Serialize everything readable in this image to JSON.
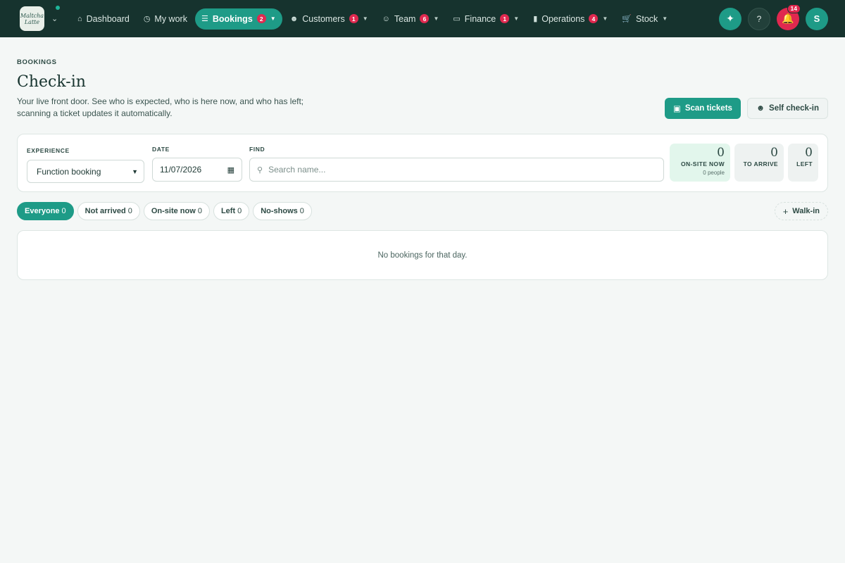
{
  "brand": {
    "logo_text": "Maltcha Latte"
  },
  "nav": {
    "items": [
      {
        "label": "Dashboard",
        "icon": "home-icon",
        "badge": null,
        "has_menu": false,
        "active": false
      },
      {
        "label": "My work",
        "icon": "clock-icon",
        "badge": null,
        "has_menu": false,
        "active": false
      },
      {
        "label": "Bookings",
        "icon": "list-icon",
        "badge": "2",
        "has_menu": true,
        "active": true
      },
      {
        "label": "Customers",
        "icon": "users-icon",
        "badge": "1",
        "has_menu": true,
        "active": false
      },
      {
        "label": "Team",
        "icon": "person-icon",
        "badge": "6",
        "has_menu": true,
        "active": false
      },
      {
        "label": "Finance",
        "icon": "card-icon",
        "badge": "1",
        "has_menu": true,
        "active": false
      },
      {
        "label": "Operations",
        "icon": "clipboard-icon",
        "badge": "4",
        "has_menu": true,
        "active": false
      },
      {
        "label": "Stock",
        "icon": "cart-icon",
        "badge": null,
        "has_menu": true,
        "active": false
      }
    ]
  },
  "topbar": {
    "notifications_count": "14",
    "avatar_initial": "S"
  },
  "page": {
    "eyebrow": "BOOKINGS",
    "title": "Check-in",
    "subtitle": "Your live front door. See who is expected, who is here now, and who has left; scanning a ticket updates it automatically.",
    "scan_label": "Scan tickets",
    "self_checkin_label": "Self check-in"
  },
  "filters": {
    "experience_label": "EXPERIENCE",
    "experience_value": "Function booking",
    "date_label": "DATE",
    "date_value": "11/07/2026",
    "find_label": "FIND",
    "find_placeholder": "Search name..."
  },
  "stats": {
    "onsite_value": "0",
    "onsite_label": "ON-SITE NOW",
    "onsite_sub": "0 people",
    "arrive_value": "0",
    "arrive_label": "TO ARRIVE",
    "left_value": "0",
    "left_label": "LEFT"
  },
  "tabs": [
    {
      "label": "Everyone",
      "count": "0"
    },
    {
      "label": "Not arrived",
      "count": "0"
    },
    {
      "label": "On-site now",
      "count": "0"
    },
    {
      "label": "Left",
      "count": "0"
    },
    {
      "label": "No-shows",
      "count": "0"
    }
  ],
  "walkin_label": "Walk-in",
  "empty_message": "No bookings for that day.",
  "colors": {
    "accent": "#1e9b87",
    "nav_bg": "#16332e",
    "badge": "#e0284f"
  }
}
